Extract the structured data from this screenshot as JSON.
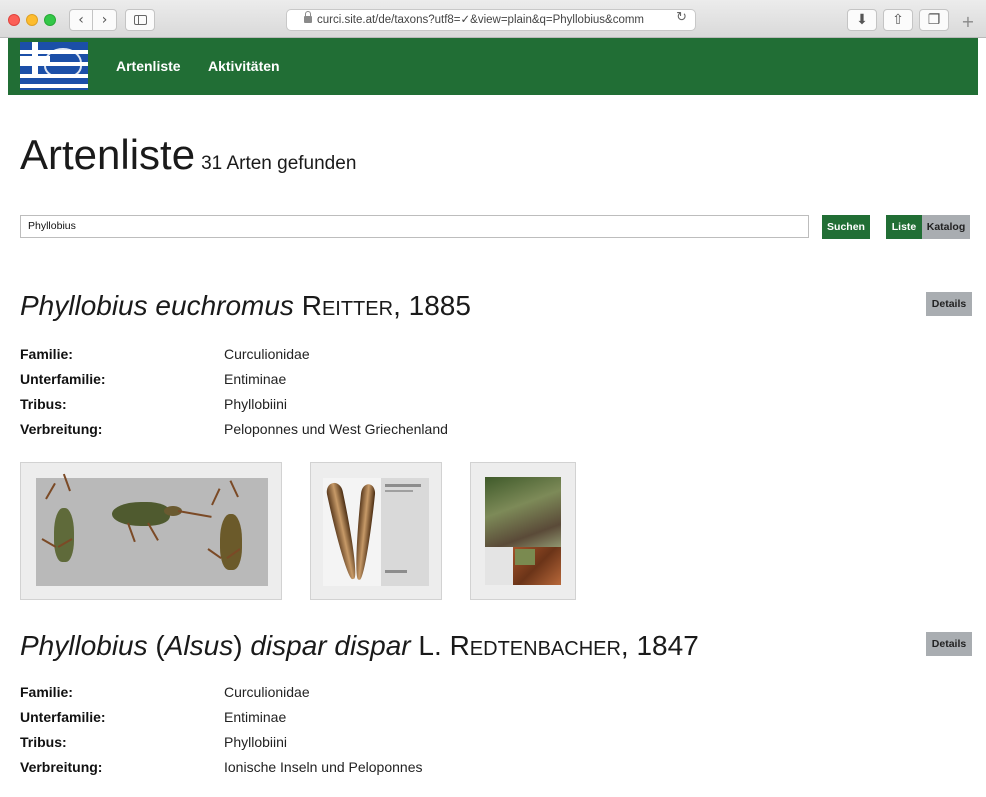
{
  "browser": {
    "url": "curci.site.at/de/taxons?utf8=✓&view=plain&q=Phyllobius&comm",
    "icons": {
      "back": "chevron-left-icon",
      "forward": "chevron-right-icon",
      "sidebar": "sidebar-icon",
      "lock": "lock-icon",
      "reload": "reload-icon",
      "download": "download-icon",
      "share": "share-icon",
      "tabs": "tabs-icon",
      "new_tab": "plus-icon"
    }
  },
  "header": {
    "nav": [
      "Artenliste",
      "Aktivitäten"
    ],
    "color": "#216e35"
  },
  "page": {
    "title": "Artenliste",
    "count": "31 Arten gefunden"
  },
  "search": {
    "value": "Phyllobius",
    "button": "Suchen",
    "view_list": "Liste",
    "view_catalog": "Katalog"
  },
  "labels": {
    "familie": "Familie:",
    "unterfamilie": "Unterfamilie:",
    "tribus": "Tribus:",
    "verbreitung": "Verbreitung:",
    "details": "Details"
  },
  "taxa": [
    {
      "genus": "Phyllobius",
      "subgenus": "",
      "species": "euchromus",
      "author": "Reitter",
      "year": ", 1885",
      "familie": "Curculionidae",
      "unterfamilie": "Entiminae",
      "tribus": "Phyllobiini",
      "verbreitung": "Peloponnes und West Griechenland"
    },
    {
      "genus": "Phyllobius",
      "subgenus": "Alsus",
      "species": "dispar dispar",
      "author_prefix": "L. ",
      "author": "Redtenbacher",
      "year": ", 1847",
      "familie": "Curculionidae",
      "unterfamilie": "Entiminae",
      "tribus": "Phyllobiini",
      "verbreitung": "Ionische Inseln und Peloponnes"
    }
  ]
}
